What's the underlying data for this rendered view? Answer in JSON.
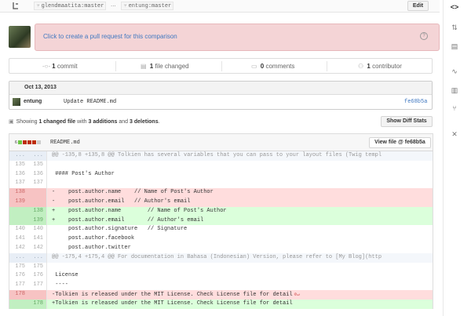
{
  "compare": {
    "base_branch": "glendmaatita:master",
    "separator": "...",
    "head_branch": "entung:master",
    "edit_label": "Edit"
  },
  "pull_request": {
    "prompt": "Click to create a pull request for this comparison",
    "help_glyph": "?"
  },
  "stats": {
    "commits_count": "1",
    "commits_label": "commit",
    "files_count": "1",
    "files_label": "file changed",
    "comments_count": "0",
    "comments_label": "comments",
    "contributors_count": "1",
    "contributors_label": "contributor"
  },
  "commits": {
    "date": "Oct 13, 2013",
    "author": "entung",
    "message": "Update README.md",
    "sha": "fe68b5a"
  },
  "summary": {
    "prefix": "Showing",
    "files": "1 changed file",
    "with": "with",
    "additions": "3 additions",
    "and": "and",
    "deletions": "3 deletions",
    "suffix": ".",
    "show_diff_stats_label": "Show Diff Stats"
  },
  "file": {
    "diffstat_count": "6",
    "diffstat_colors": [
      "#6cc644",
      "#bd2c00",
      "#bd2c00",
      "#bd2c00",
      "#cccccc"
    ],
    "name": "README.md",
    "view_file_label": "View file @ fe68b5a"
  },
  "diff_lines": [
    {
      "type": "hunk",
      "old": "...",
      "new": "...",
      "text": "@@ -135,8 +135,8 @@ Tolkien has several variables that you can pass to your layout files (Twig templ"
    },
    {
      "type": "ctx",
      "old": "135",
      "new": "135",
      "text": ""
    },
    {
      "type": "ctx",
      "old": "136",
      "new": "136",
      "text": " #### Post's Author"
    },
    {
      "type": "ctx",
      "old": "137",
      "new": "137",
      "text": ""
    },
    {
      "type": "del",
      "old": "138",
      "new": "",
      "text": "-    post.author.name    // Name of Post's Author"
    },
    {
      "type": "del",
      "old": "139",
      "new": "",
      "text": "-    post.author.email   // Author's email"
    },
    {
      "type": "add",
      "old": "",
      "new": "138",
      "text": "+    post.author.name        // Name of Post's Author"
    },
    {
      "type": "add",
      "old": "",
      "new": "139",
      "text": "+    post.author.email       // Author's email"
    },
    {
      "type": "ctx",
      "old": "140",
      "new": "140",
      "text": "     post.author.signature   // Signature"
    },
    {
      "type": "ctx",
      "old": "141",
      "new": "141",
      "text": "     post.author.facebook"
    },
    {
      "type": "ctx",
      "old": "142",
      "new": "142",
      "text": "     post.author.twitter"
    },
    {
      "type": "hunk",
      "old": "...",
      "new": "...",
      "text": "@@ -175,4 +175,4 @@ For documentation in Bahasa (Indonesian) Version, please refer to [My Blog](http"
    },
    {
      "type": "ctx",
      "old": "175",
      "new": "175",
      "text": ""
    },
    {
      "type": "ctx",
      "old": "176",
      "new": "176",
      "text": " License"
    },
    {
      "type": "ctx",
      "old": "177",
      "new": "177",
      "text": " ----"
    },
    {
      "type": "del",
      "old": "178",
      "new": "",
      "text": "-Tolkien is released under the MIT License. Check License file for detail",
      "noeol": "⊘↵"
    },
    {
      "type": "add",
      "old": "",
      "new": "178",
      "text": "+Tolkien is released under the MIT License. Check License file for detail"
    }
  ]
}
